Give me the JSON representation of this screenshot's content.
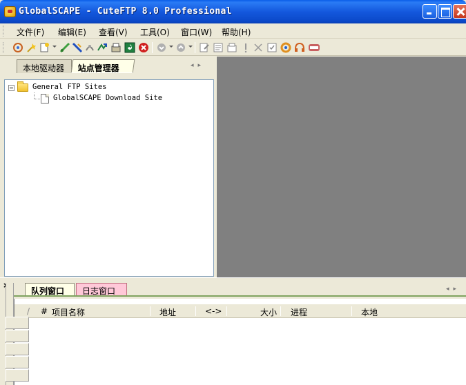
{
  "window": {
    "title": "GlobalSCAPE - CuteFTP 8.0 Professional"
  },
  "menu": {
    "items": [
      "文件(F)",
      "编辑(E)",
      "查看(V)",
      "工具(O)",
      "窗口(W)",
      "帮助(H)"
    ]
  },
  "toolbar": {
    "icons": [
      "connect-wizard-icon",
      "quick-connect-icon",
      "new-site-icon",
      "connect-icon",
      "disconnect-icon",
      "reconnect-icon",
      "stop-icon",
      "refresh-icon",
      "download-icon",
      "stop-transfer-icon",
      "back-icon",
      "forward-icon",
      "edit-icon",
      "view-icon",
      "new-folder-icon",
      "rename-icon",
      "delete-icon",
      "properties-icon",
      "sync-icon",
      "help-icon",
      "logo-icon"
    ]
  },
  "left_panel": {
    "tabs": [
      "本地驱动器",
      "站点管理器"
    ],
    "active_tab": "站点管理器",
    "tree": {
      "root": "General FTP Sites",
      "children": [
        "GlobalSCAPE Download Site"
      ]
    }
  },
  "bottom_panel": {
    "tabs": [
      "队列窗口",
      "日志窗口"
    ],
    "active_tab": "队列窗口",
    "columns": [
      "/",
      "#",
      "项目名称",
      "地址",
      "<->",
      "大小",
      "进程",
      "本地"
    ]
  },
  "colors": {
    "titlebar": "#0A5EE8",
    "workspace": "#808080",
    "face": "#ECE9D8",
    "log_tab": "#FFC8D8"
  }
}
